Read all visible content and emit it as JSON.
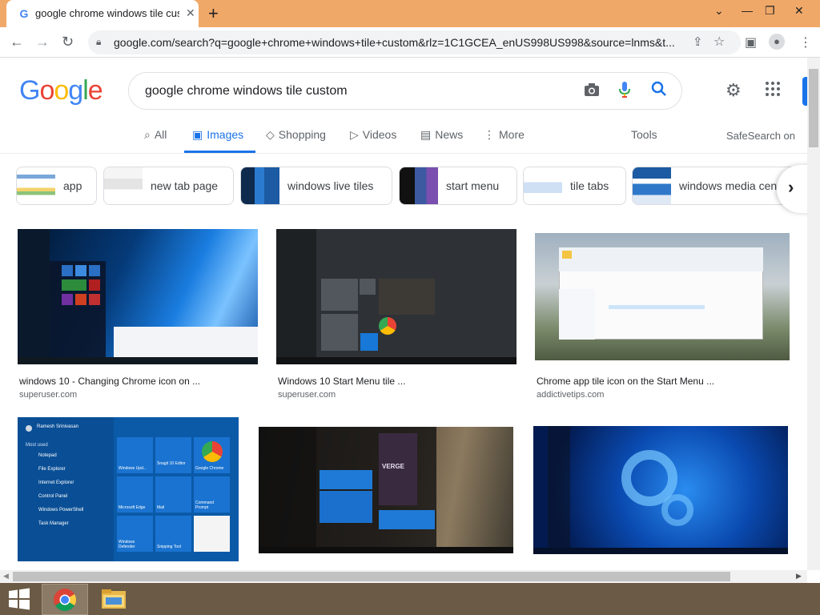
{
  "browser": {
    "tab_title": "google chrome windows tile custom",
    "tab_close": "✕",
    "new_tab": "+",
    "url": "google.com/search?q=google+chrome+windows+tile+custom&rlz=1C1GCEA_enUS998US998&source=lnms&t...",
    "window_controls": {
      "chevron": "⌄",
      "minimize": "—",
      "restore": "❐",
      "close": "✕"
    },
    "nav": {
      "back": "←",
      "forward": "→",
      "reload": "↻"
    }
  },
  "google": {
    "logo": [
      "G",
      "o",
      "o",
      "g",
      "l",
      "e"
    ],
    "logo_colors": [
      "#4285f4",
      "#ea4335",
      "#fbbc05",
      "#4285f4",
      "#34a853",
      "#ea4335"
    ],
    "query": "google chrome windows tile custom"
  },
  "search_tabs": [
    {
      "icon": "⌕",
      "label": "All"
    },
    {
      "icon": "▣",
      "label": "Images"
    },
    {
      "icon": "◇",
      "label": "Shopping"
    },
    {
      "icon": "▷",
      "label": "Videos"
    },
    {
      "icon": "▤",
      "label": "News"
    },
    {
      "icon": "⋮",
      "label": "More"
    }
  ],
  "tools_label": "Tools",
  "safesearch_label": "SafeSearch on",
  "chips": [
    {
      "label": "app"
    },
    {
      "label": "new tab page"
    },
    {
      "label": "windows live tiles"
    },
    {
      "label": "start menu"
    },
    {
      "label": "tile tabs"
    },
    {
      "label": "windows media center"
    }
  ],
  "results": [
    {
      "title": "windows 10 - Changing Chrome icon on ...",
      "source": "superuser.com"
    },
    {
      "title": "Windows 10 Start Menu tile ...",
      "source": "superuser.com"
    },
    {
      "title": "Chrome app tile icon on the Start Menu ...",
      "source": "addictivetips.com"
    },
    {
      "title": "",
      "source": ""
    },
    {
      "title": "",
      "source": ""
    },
    {
      "title": "",
      "source": ""
    }
  ],
  "thumb_text": {
    "user_name": "Ramesh Srinivasan",
    "most_used": "Most used",
    "menu_items": [
      "Notepad",
      "File Explorer",
      "Internet Explorer",
      "Control Panel",
      "Windows PowerShell",
      "Task Manager"
    ],
    "tiles": [
      "Windows Upd...",
      "Snagit 10 Editor",
      "Google Chrome",
      "Microsoft Edge",
      "Mail",
      "Command Prompt",
      "Windows Defender",
      "Snipping Tool"
    ],
    "verge": "VERGE"
  },
  "colors": {
    "tabbar": "#f0a868",
    "accent": "#1a73e8",
    "taskbar": "#6b5a45",
    "win_blue": "#0b5aa8"
  }
}
